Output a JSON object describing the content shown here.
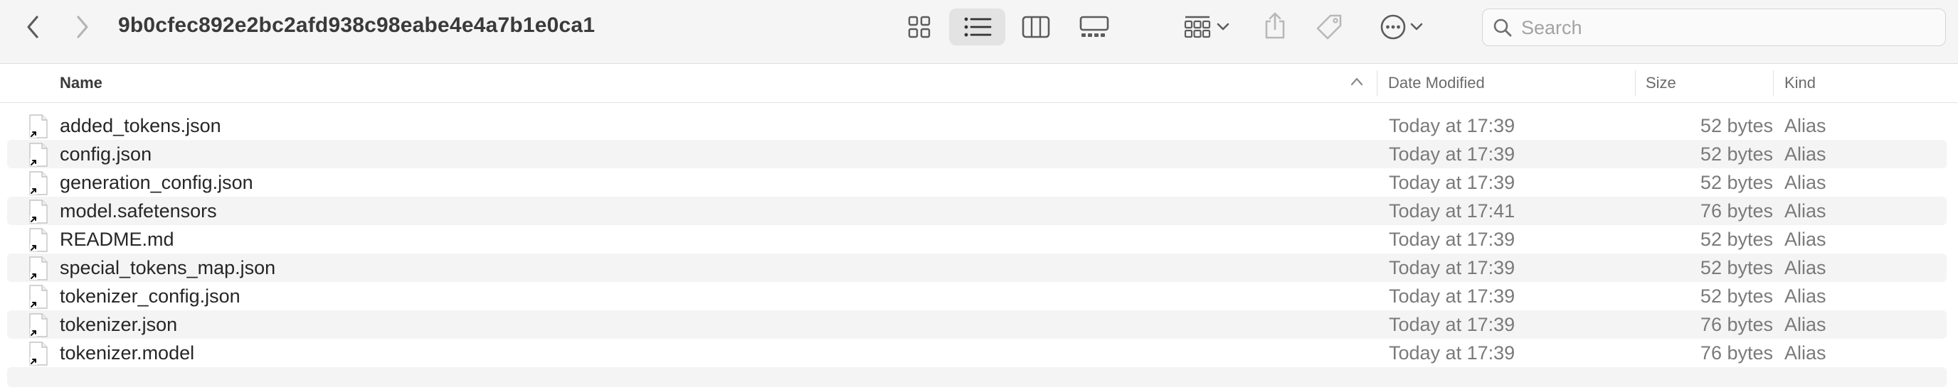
{
  "window": {
    "title": "9b0cfec892e2bc2afd938c98eabe4e4a7b1e0ca1"
  },
  "toolbar": {
    "back_icon": "chevron-left-icon",
    "forward_icon": "chevron-right-icon",
    "views": [
      "icon-view-icon",
      "list-view-icon",
      "column-view-icon",
      "gallery-view-icon"
    ],
    "selected_view": "list",
    "group_icon": "group-by-icon",
    "share_icon": "share-icon",
    "tag_icon": "tag-icon",
    "more_icon": "ellipsis-circle-icon"
  },
  "search": {
    "placeholder": "Search",
    "value": ""
  },
  "columns": {
    "name": "Name",
    "date": "Date Modified",
    "size": "Size",
    "kind": "Kind"
  },
  "files": [
    {
      "name": "added_tokens.json",
      "date": "Today at 17:39",
      "size": "52 bytes",
      "kind": "Alias"
    },
    {
      "name": "config.json",
      "date": "Today at 17:39",
      "size": "52 bytes",
      "kind": "Alias"
    },
    {
      "name": "generation_config.json",
      "date": "Today at 17:39",
      "size": "52 bytes",
      "kind": "Alias"
    },
    {
      "name": "model.safetensors",
      "date": "Today at 17:41",
      "size": "76 bytes",
      "kind": "Alias"
    },
    {
      "name": "README.md",
      "date": "Today at 17:39",
      "size": "52 bytes",
      "kind": "Alias"
    },
    {
      "name": "special_tokens_map.json",
      "date": "Today at 17:39",
      "size": "52 bytes",
      "kind": "Alias"
    },
    {
      "name": "tokenizer_config.json",
      "date": "Today at 17:39",
      "size": "52 bytes",
      "kind": "Alias"
    },
    {
      "name": "tokenizer.json",
      "date": "Today at 17:39",
      "size": "76 bytes",
      "kind": "Alias"
    },
    {
      "name": "tokenizer.model",
      "date": "Today at 17:39",
      "size": "76 bytes",
      "kind": "Alias"
    }
  ]
}
